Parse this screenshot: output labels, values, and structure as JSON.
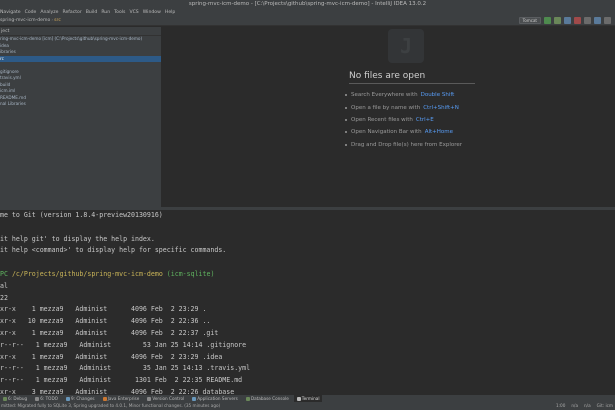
{
  "window": {
    "title": "spring-mvc-icm-demo - [C:\\Projects\\github\\spring-mvc-icm-demo] - IntelliJ IDEA 13.0.2"
  },
  "menu": [
    "Navigate",
    "Code",
    "Analyze",
    "Refactor",
    "Build",
    "Run",
    "Tools",
    "VCS",
    "Window",
    "Help"
  ],
  "breadcrumb": [
    "spring-mvc-icm-demo",
    "src"
  ],
  "run_config": "Tomcat",
  "project_panel": {
    "header": "ject",
    "items": [
      {
        "label": "ring-mvc-icm-demo [icm] (C:\\Projects\\github\\spring-mvc-icm-demo)",
        "selected": false
      },
      {
        "label": "idea",
        "selected": false
      },
      {
        "label": "ibraries",
        "selected": false
      },
      {
        "label": "rc",
        "selected": true
      },
      {
        "label": "",
        "selected": false
      },
      {
        "label": "gitignore",
        "selected": false
      },
      {
        "label": "travis.yml",
        "selected": false
      },
      {
        "label": "build",
        "selected": false
      },
      {
        "label": "icm.iml",
        "selected": false
      },
      {
        "label": "README.md",
        "selected": false
      },
      {
        "label": "nal Libraries",
        "selected": false
      }
    ]
  },
  "editor": {
    "logo_glyph": "J",
    "no_files_title": "No files are open",
    "hints": [
      {
        "text": "Search Everywhere with",
        "key": "Double Shift"
      },
      {
        "text": "Open a file by name with",
        "key": "Ctrl+Shift+N"
      },
      {
        "text": "Open Recent files with",
        "key": "Ctrl+E"
      },
      {
        "text": "Open Navigation Bar with",
        "key": "Alt+Home"
      },
      {
        "text": "Drag and Drop file(s) here from Explorer",
        "key": ""
      }
    ]
  },
  "terminal": {
    "welcome": "me to Git (version 1.8.4-preview20130916)",
    "blank1": "",
    "help1": "it help git' to display the help index.",
    "help2": "it help <command>' to display help for specific commands.",
    "blank2": "",
    "prompt_user": "PC",
    "prompt_path": "/c/Projects/github/spring-mvc-icm-demo",
    "prompt_branch": "(icm-sqlite)",
    "cmd": "al",
    "total": "22",
    "listing": [
      "xr-x    1 mezza9   Administ      4096 Feb  2 23:29 .",
      "xr-x   10 mezza9   Administ      4096 Feb  2 22:36 ..",
      "xr-x    1 mezza9   Administ      4096 Feb  2 22:37 .git",
      "r--r--   1 mezza9   Administ        53 Jan 25 14:14 .gitignore",
      "xr-x    1 mezza9   Administ      4096 Feb  2 23:29 .idea",
      "r--r--   1 mezza9   Administ        35 Jan 25 14:13 .travis.yml",
      "r--r--   1 mezza9   Administ      1301 Feb  2 22:35 README.md",
      "xr-x    3 mezza9   Administ      4096 Feb  2 22:26 database"
    ]
  },
  "tool_windows": [
    {
      "label": "6: Debug",
      "color": "#6a8759",
      "active": false
    },
    {
      "label": "6: TODO",
      "color": "#8a8a8a",
      "active": false
    },
    {
      "label": "9: Changes",
      "color": "#6897bb",
      "active": false
    },
    {
      "label": "Java Enterprise",
      "color": "#cc7832",
      "active": false
    },
    {
      "label": "Version Control",
      "color": "#8a8a8a",
      "active": false
    },
    {
      "label": "Application Servers",
      "color": "#6897bb",
      "active": false
    },
    {
      "label": "Database Console",
      "color": "#6a8759",
      "active": false
    },
    {
      "label": "Terminal",
      "color": "#bbbbbb",
      "active": true
    }
  ],
  "status": {
    "message": "mitted: Migrated fully to SQLite 3, Spring upgraded to 4.0.1, Minor functional changes. (35 minutes ago)",
    "position": "1:00",
    "encoding": "n/a",
    "extra": "n/a",
    "git": "Git: icm"
  }
}
